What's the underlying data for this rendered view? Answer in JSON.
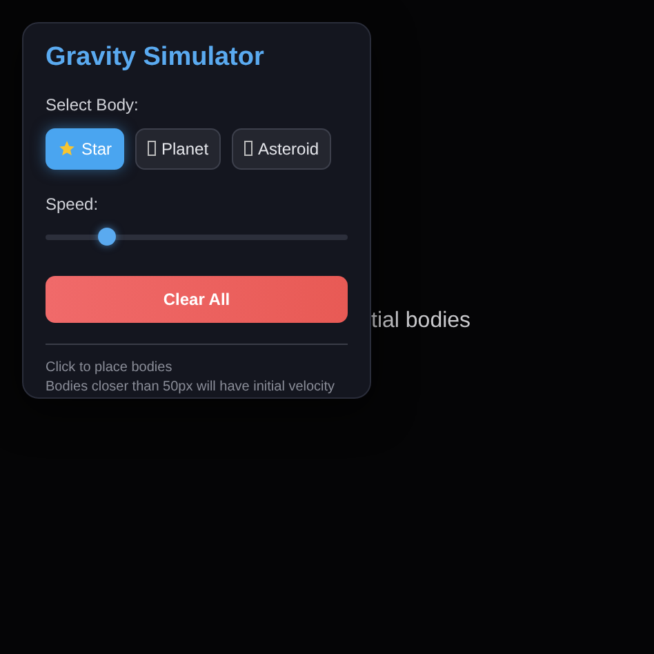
{
  "background_text": "tial bodies",
  "panel": {
    "title": "Gravity Simulator",
    "select_label": "Select Body:",
    "bodies": [
      {
        "label": "Star",
        "kind": "star",
        "selected": true
      },
      {
        "label": "Planet",
        "kind": "missing",
        "selected": false
      },
      {
        "label": "Asteroid",
        "kind": "missing",
        "selected": false
      }
    ],
    "speed": {
      "label": "Speed:",
      "level": 0.2
    },
    "clear_button": "Clear All",
    "hints": [
      "Click to place bodies",
      "Bodies closer than 50px will have initial velocity"
    ]
  }
}
